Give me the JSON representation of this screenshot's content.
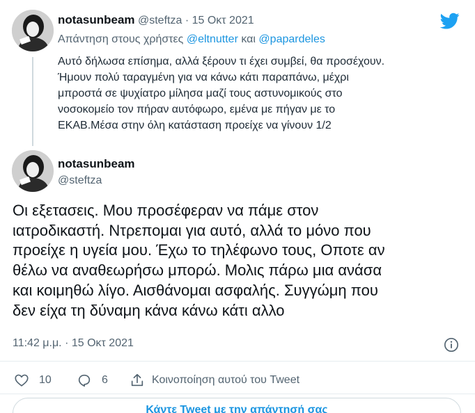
{
  "reply_tweet": {
    "display_name": "notasunbeam",
    "handle": "@steftza",
    "separator": "·",
    "date": "15 Οκτ 2021",
    "replying_prefix": "Απάντηση στους χρήστες",
    "mention_1": "@eltnutter",
    "replying_and": "και",
    "mention_2": "@papardeles",
    "text_lines": [
      "Αυτό δήλωσα επίσημα, αλλά ξέρουν τι έχει συμβεί, θα προσέχουν.",
      "Ήμουν πολύ ταραγμένη για να κάνω κάτι παραπάνω, μέχρι",
      "μπροστά σε ψυχίατρο μίλησα μαζί τους αστυνομικούς στο",
      "νοσοκομείο τον πήραν αυτόφωρο, εμένα με πήγαν με το",
      "ΕΚΑΒ.Μέσα στην όλη κατάσταση προείχε να γίνουν 1/2"
    ]
  },
  "main_tweet": {
    "display_name": "notasunbeam",
    "handle": "@steftza",
    "text_lines": [
      "Οι εξετασεις. Μου προσέφεραν να πάμε στον",
      "ιατροδικαστή. Ντρεπομαι για αυτό, αλλά το μόνο που",
      "προείχε η υγεία μου. Έχω το τηλέφωνο τους, Οποτε αν",
      "θέλω να αναθεωρήσω μπορώ. Μολις πάρω μια ανάσα",
      "και κοιμηθώ λίγο. Αισθάνομαι ασφαλής. Συγγώμη που",
      "δεν είχα τη δύναμη κάνα κάνω κάτι αλλο"
    ],
    "timestamp": "11:42 μ.μ. · 15 Οκτ 2021"
  },
  "actions": {
    "likes": "10",
    "replies": "6",
    "share_label": "Κοινοποίηση αυτού του Tweet"
  },
  "reply_prompt": "Κάντε Tweet με την απάντησή σας",
  "icons": {
    "brand": "twitter-bird-icon",
    "like": "heart-icon",
    "reply": "speech-bubble-icon",
    "share": "share-icon",
    "info": "info-icon"
  },
  "colors": {
    "brand": "#1da1f2",
    "link": "#1b95e0",
    "secondary_text": "#536471",
    "primary_text": "#0f1419"
  }
}
